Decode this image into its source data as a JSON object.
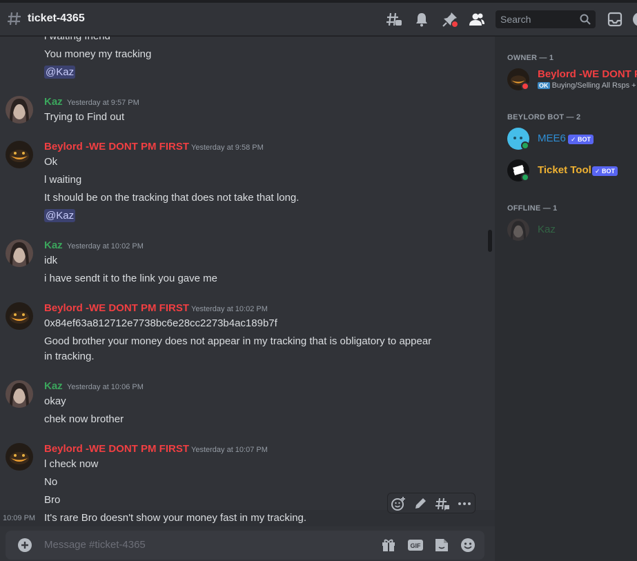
{
  "channel": {
    "name": "ticket-4365"
  },
  "search": {
    "placeholder": "Search"
  },
  "messages": {
    "m0": {
      "l1": "l waiting friend",
      "l2": "You money my tracking",
      "mention": "@Kaz"
    },
    "m1": {
      "author": "Kaz",
      "time": "Yesterday at 9:57 PM",
      "l1": "Trying to Find out"
    },
    "m2": {
      "author": "Beylord  -WE DONT PM FIRST",
      "time": "Yesterday at 9:58 PM",
      "l1": "Ok",
      "l2": "l waiting",
      "l3": "It should be on the tracking that does not take that long.",
      "mention": "@Kaz"
    },
    "m3": {
      "author": "Kaz",
      "time": "Yesterday at 10:02 PM",
      "l1": "idk",
      "l2": "i have sendt it to the link you gave me"
    },
    "m4": {
      "author": "Beylord  -WE DONT PM FIRST",
      "time": "Yesterday at 10:02 PM",
      "l1": "0x84ef63a812712e7738bc6e28cc2273b4ac189b7f",
      "l2": "Good brother your money does not appear in my tracking that is obligatory to appear",
      "l3": "in tracking."
    },
    "m5": {
      "author": "Kaz",
      "time": "Yesterday at 10:06 PM",
      "l1": "okay",
      "l2": "chek now brother"
    },
    "m6": {
      "author": "Beylord  -WE DONT PM FIRST",
      "time": "Yesterday at 10:07 PM",
      "l1": "l check now",
      "l2": "No",
      "l3": "Bro",
      "l4": "It's rare Bro doesn't show your money fast in my tracking.",
      "l4_time": "10:09 PM"
    }
  },
  "composer": {
    "placeholder": "Message #ticket-4365"
  },
  "members": {
    "owner_header": "OWNER — 1",
    "owner": {
      "name": "Beylord -WE DONT P",
      "status_tag": "OK",
      "status_text": "Buying/Selling All Rsps +"
    },
    "bot_header": "BEYLORD BOT — 2",
    "bots": [
      {
        "name": "MEE6",
        "badge": "✓ BOT",
        "color": "#2f8fd6"
      },
      {
        "name": "Ticket Tool",
        "badge": "✓ BOT",
        "color": "#f0b232"
      }
    ],
    "offline_header": "OFFLINE — 1",
    "offline": {
      "name": "Kaz"
    }
  },
  "colors": {
    "kaz": "#3ba55c",
    "beylord": "#f23f42",
    "accent": "#5865f2"
  }
}
